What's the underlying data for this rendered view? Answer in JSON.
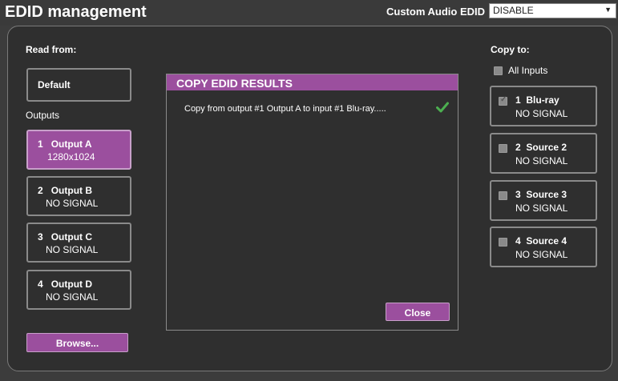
{
  "header": {
    "title": "EDID management",
    "audio_label": "Custom Audio EDID",
    "audio_value": "DISABLE"
  },
  "read_from": {
    "label": "Read from:",
    "default_label": "Default",
    "outputs_label": "Outputs",
    "outputs": [
      {
        "number": "1",
        "name": "Output A",
        "status": "1280x1024",
        "selected": true
      },
      {
        "number": "2",
        "name": "Output B",
        "status": "NO SIGNAL",
        "selected": false
      },
      {
        "number": "3",
        "name": "Output C",
        "status": "NO SIGNAL",
        "selected": false
      },
      {
        "number": "4",
        "name": "Output D",
        "status": "NO SIGNAL",
        "selected": false
      }
    ],
    "browse_label": "Browse..."
  },
  "dialog": {
    "title": "COPY EDID RESULTS",
    "message": "Copy from output #1 Output A to input #1 Blu-ray.....",
    "close_label": "Close",
    "success_color": "#4caf50"
  },
  "copy_to": {
    "label": "Copy to:",
    "all_inputs_label": "All Inputs",
    "inputs": [
      {
        "number": "1",
        "name": "Blu-ray",
        "status": "NO SIGNAL",
        "checked": true
      },
      {
        "number": "2",
        "name": "Source 2",
        "status": "NO SIGNAL",
        "checked": false
      },
      {
        "number": "3",
        "name": "Source 3",
        "status": "NO SIGNAL",
        "checked": false
      },
      {
        "number": "4",
        "name": "Source 4",
        "status": "NO SIGNAL",
        "checked": false
      }
    ]
  },
  "colors": {
    "accent": "#9b4f9e",
    "background": "#3c3c3c",
    "panel": "#2f2f2f"
  }
}
